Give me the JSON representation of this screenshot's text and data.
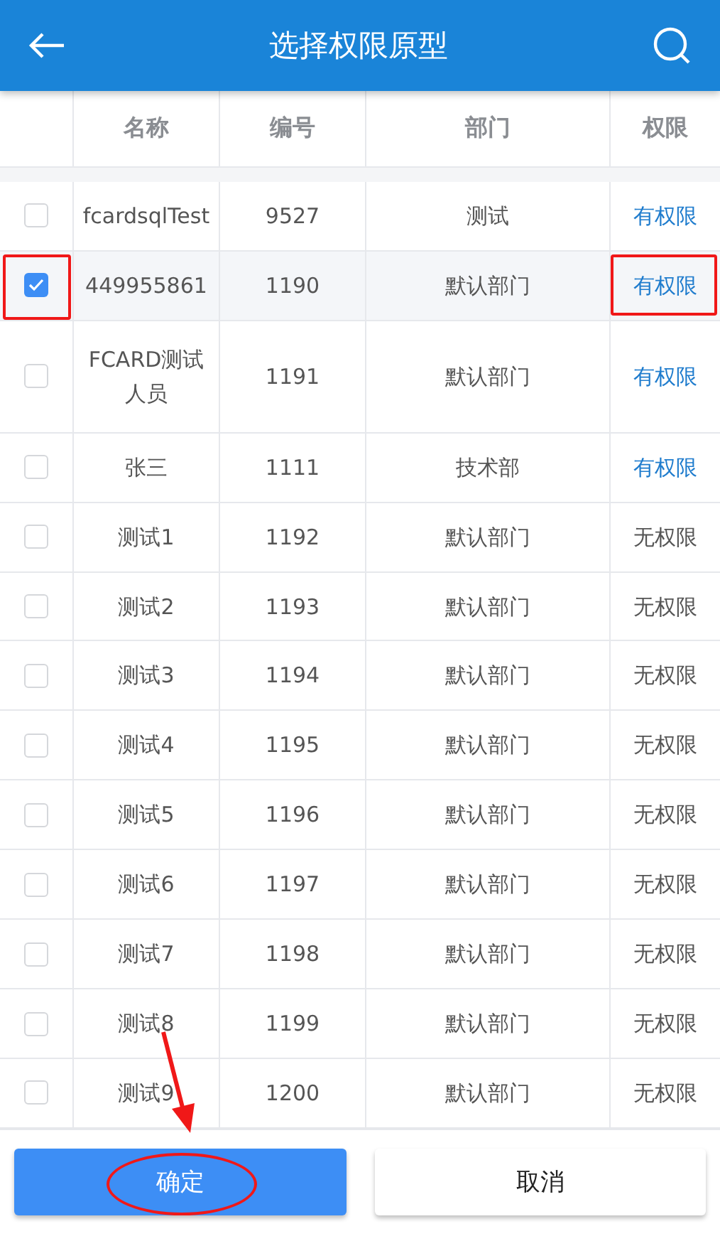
{
  "header": {
    "title": "选择权限原型"
  },
  "table": {
    "columns": [
      "名称",
      "编号",
      "部门",
      "权限"
    ],
    "rows": [
      {
        "name": "fcardsqlTest",
        "number": "9527",
        "department": "测试",
        "permission": "有权限",
        "granted": true,
        "checked": false,
        "checkbox_marked": false,
        "permission_marked": false
      },
      {
        "name": "449955861",
        "number": "1190",
        "department": "默认部门",
        "permission": "有权限",
        "granted": true,
        "checked": true,
        "checkbox_marked": true,
        "permission_marked": true
      },
      {
        "name": "FCARD测试人员",
        "number": "1191",
        "department": "默认部门",
        "permission": "有权限",
        "granted": true,
        "checked": false,
        "checkbox_marked": false,
        "permission_marked": false
      },
      {
        "name": "张三",
        "number": "1111",
        "department": "技术部",
        "permission": "有权限",
        "granted": true,
        "checked": false,
        "checkbox_marked": false,
        "permission_marked": false
      },
      {
        "name": "测试1",
        "number": "1192",
        "department": "默认部门",
        "permission": "无权限",
        "granted": false,
        "checked": false,
        "checkbox_marked": false,
        "permission_marked": false
      },
      {
        "name": "测试2",
        "number": "1193",
        "department": "默认部门",
        "permission": "无权限",
        "granted": false,
        "checked": false,
        "checkbox_marked": false,
        "permission_marked": false
      },
      {
        "name": "测试3",
        "number": "1194",
        "department": "默认部门",
        "permission": "无权限",
        "granted": false,
        "checked": false,
        "checkbox_marked": false,
        "permission_marked": false
      },
      {
        "name": "测试4",
        "number": "1195",
        "department": "默认部门",
        "permission": "无权限",
        "granted": false,
        "checked": false,
        "checkbox_marked": false,
        "permission_marked": false
      },
      {
        "name": "测试5",
        "number": "1196",
        "department": "默认部门",
        "permission": "无权限",
        "granted": false,
        "checked": false,
        "checkbox_marked": false,
        "permission_marked": false
      },
      {
        "name": "测试6",
        "number": "1197",
        "department": "默认部门",
        "permission": "无权限",
        "granted": false,
        "checked": false,
        "checkbox_marked": false,
        "permission_marked": false
      },
      {
        "name": "测试7",
        "number": "1198",
        "department": "默认部门",
        "permission": "无权限",
        "granted": false,
        "checked": false,
        "checkbox_marked": false,
        "permission_marked": false
      },
      {
        "name": "测试8",
        "number": "1199",
        "department": "默认部门",
        "permission": "无权限",
        "granted": false,
        "checked": false,
        "checkbox_marked": false,
        "permission_marked": false
      },
      {
        "name": "测试9",
        "number": "1200",
        "department": "默认部门",
        "permission": "无权限",
        "granted": false,
        "checked": false,
        "checkbox_marked": false,
        "permission_marked": false
      }
    ]
  },
  "buttons": [
    {
      "label": "确定",
      "kind": "primary",
      "circled": true,
      "pointer_arrow": true
    },
    {
      "label": "取消",
      "kind": "secondary",
      "circled": false,
      "pointer_arrow": false
    }
  ]
}
